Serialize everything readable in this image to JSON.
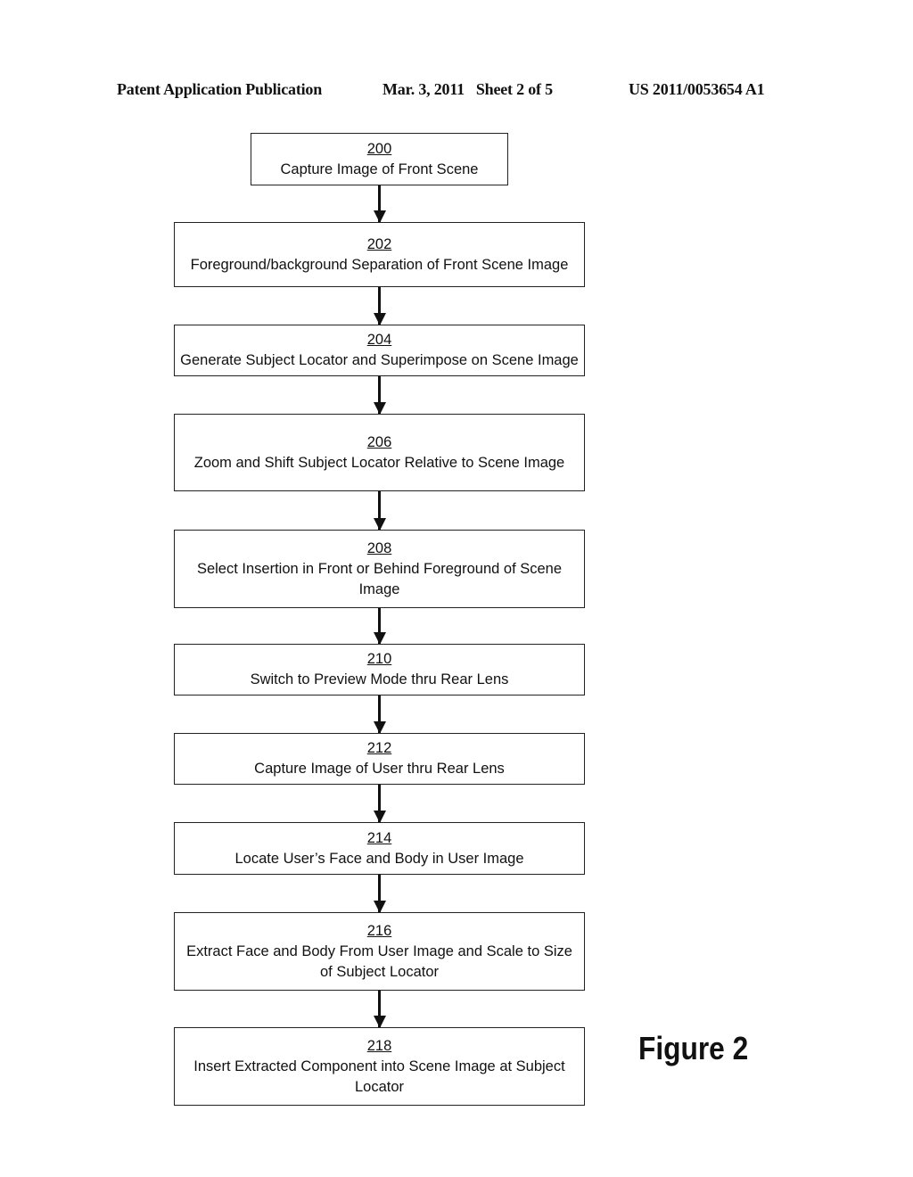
{
  "header": {
    "publication": "Patent Application Publication",
    "date_sheet": "Mar. 3, 2011   Sheet 2 of 5",
    "patent_number": "US 2011/0053654 A1"
  },
  "figure_label": "Figure 2",
  "steps": [
    {
      "num": "200",
      "text": "Capture Image of Front Scene"
    },
    {
      "num": "202",
      "text": "Foreground/background Separation of Front Scene Image"
    },
    {
      "num": "204",
      "text": "Generate Subject Locator and Superimpose on Scene Image"
    },
    {
      "num": "206",
      "text": "Zoom and Shift Subject Locator Relative to Scene Image"
    },
    {
      "num": "208",
      "text": "Select Insertion in Front or Behind Foreground of Scene Image"
    },
    {
      "num": "210",
      "text": "Switch to Preview Mode thru Rear Lens"
    },
    {
      "num": "212",
      "text": "Capture Image of User thru Rear Lens"
    },
    {
      "num": "214",
      "text": "Locate User’s Face and Body in User Image"
    },
    {
      "num": "216",
      "text": "Extract Face and Body From User Image and Scale to Size of Subject Locator"
    },
    {
      "num": "218",
      "text": "Insert Extracted Component into Scene Image at Subject Locator"
    }
  ]
}
